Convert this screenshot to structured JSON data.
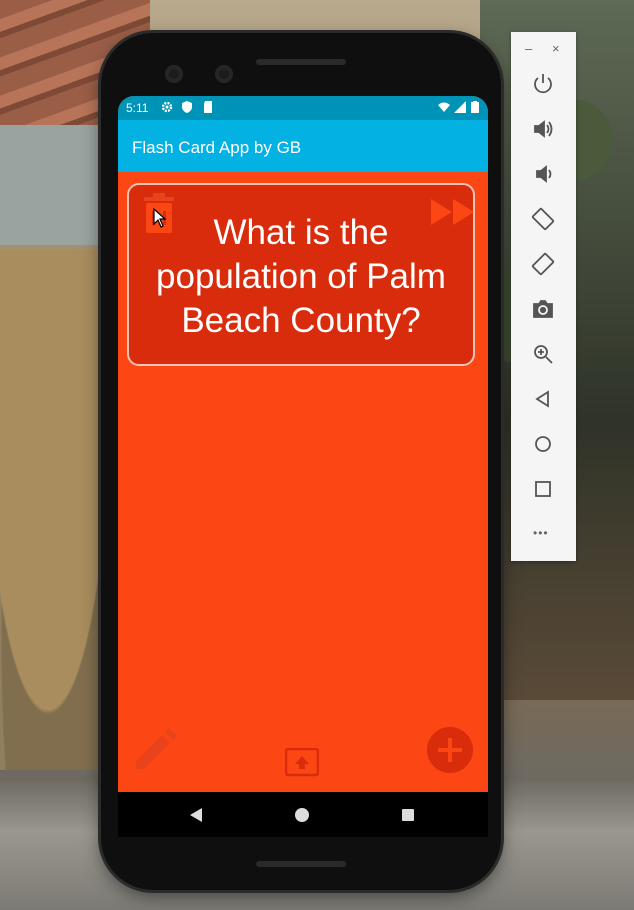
{
  "status_bar": {
    "time": "5:11"
  },
  "app_bar": {
    "title": "Flash Card App by GB"
  },
  "card": {
    "question": "What is the population of Palm Beach County?"
  },
  "icons": {
    "delete": "trash-icon",
    "next": "fast-forward-icon",
    "edit": "pencil-icon",
    "upload": "upload-icon",
    "add": "plus-icon"
  },
  "emulator_toolbar": {
    "minimize": "–",
    "close": "×",
    "more": "•••"
  },
  "colors": {
    "app_bar": "#03b2e2",
    "status_bar": "#0093b8",
    "background": "#fc4613",
    "card": "#d92c0c",
    "card_border": "#f3c3b5"
  }
}
